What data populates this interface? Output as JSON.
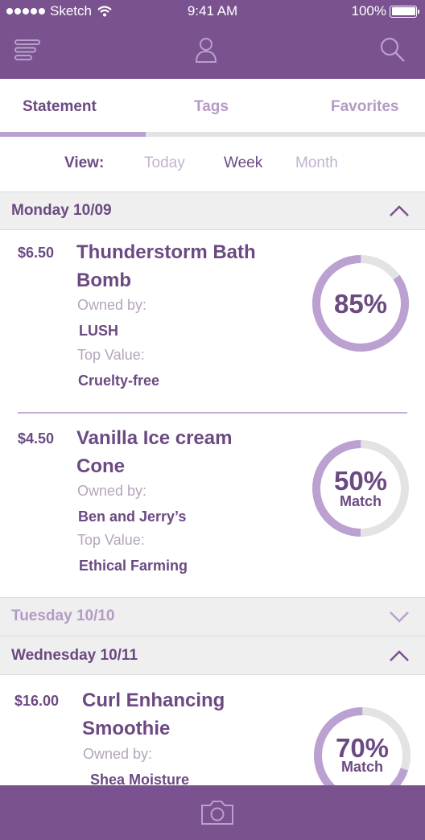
{
  "status_bar": {
    "carrier": "Sketch",
    "time": "9:41 AM",
    "battery": "100%"
  },
  "header": {
    "icons": [
      "menu-icon",
      "profile-icon",
      "search-icon"
    ]
  },
  "tabs": [
    {
      "label": "Statement",
      "active": true
    },
    {
      "label": "Tags",
      "active": false
    },
    {
      "label": "Favorites",
      "active": false
    }
  ],
  "view": {
    "label": "View:",
    "options": [
      "Today",
      "Week",
      "Month"
    ],
    "selected": "Week"
  },
  "sections": [
    {
      "label": "Monday 10/09",
      "expanded": true,
      "items": [
        {
          "price": "$6.50",
          "title_line1": "Thunderstorm Bath",
          "title_line2": "Bomb",
          "owned_label": "Owned by:",
          "owner": "LUSH",
          "value_label": "Top Value:",
          "top_value": "Cruelty-free",
          "match_pct": "85%",
          "match_label": "",
          "match_fraction": 0.85
        },
        {
          "price": "$4.50",
          "title_line1": "Vanilla Ice cream",
          "title_line2": "Cone",
          "owned_label": "Owned by:",
          "owner": "Ben and Jerry’s",
          "value_label": "Top Value:",
          "top_value": "Ethical Farming",
          "match_pct": "50%",
          "match_label": "Match",
          "match_fraction": 0.5
        }
      ]
    },
    {
      "label": "Tuesday 10/10",
      "expanded": false,
      "items": []
    },
    {
      "label": "Wednesday 10/11",
      "expanded": true,
      "items": [
        {
          "price": "$16.00",
          "title_line1": "Curl Enhancing",
          "title_line2": "Smoothie",
          "owned_label": "Owned by:",
          "owner": "Shea Moisture",
          "match_pct": "70%",
          "match_label": "Match",
          "match_fraction": 0.7
        }
      ]
    }
  ],
  "footer": {
    "icon": "camera-icon"
  },
  "colors": {
    "primary": "#7a528f",
    "text": "#6b4a82",
    "accent": "#bba0d2",
    "muted": "#b49bc4",
    "track": "#e3e3e3"
  }
}
